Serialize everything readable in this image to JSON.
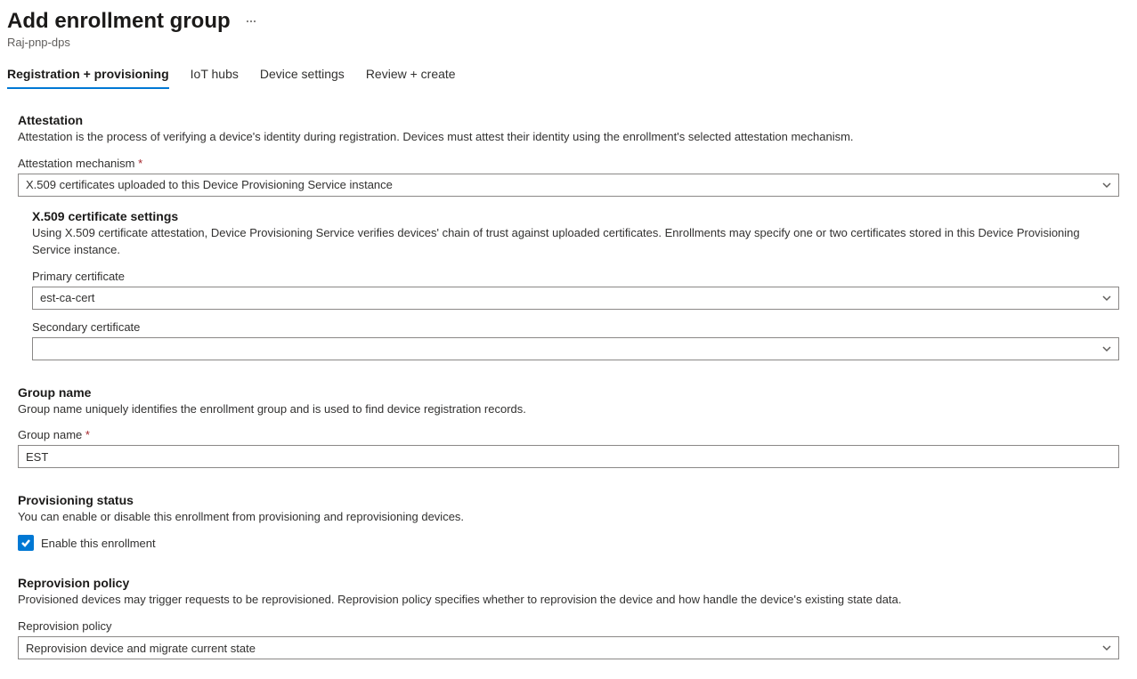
{
  "header": {
    "title": "Add enrollment group",
    "subtitle": "Raj-pnp-dps"
  },
  "tabs": [
    {
      "label": "Registration + provisioning",
      "active": true
    },
    {
      "label": "IoT hubs",
      "active": false
    },
    {
      "label": "Device settings",
      "active": false
    },
    {
      "label": "Review + create",
      "active": false
    }
  ],
  "attestation": {
    "title": "Attestation",
    "desc": "Attestation is the process of verifying a device's identity during registration. Devices must attest their identity using the enrollment's selected attestation mechanism.",
    "mechanism_label": "Attestation mechanism",
    "mechanism_value": "X.509 certificates uploaded to this Device Provisioning Service instance"
  },
  "x509": {
    "title": "X.509 certificate settings",
    "desc": "Using X.509 certificate attestation, Device Provisioning Service verifies devices' chain of trust against uploaded certificates. Enrollments may specify one or two certificates stored in this Device Provisioning Service instance.",
    "primary_label": "Primary certificate",
    "primary_value": "est-ca-cert",
    "secondary_label": "Secondary certificate",
    "secondary_value": ""
  },
  "group": {
    "title": "Group name",
    "desc": "Group name uniquely identifies the enrollment group and is used to find device registration records.",
    "name_label": "Group name",
    "name_value": "EST"
  },
  "provisioning": {
    "title": "Provisioning status",
    "desc": "You can enable or disable this enrollment from provisioning and reprovisioning devices.",
    "enable_label": "Enable this enrollment",
    "enabled": true
  },
  "reprovision": {
    "title": "Reprovision policy",
    "desc": "Provisioned devices may trigger requests to be reprovisioned. Reprovision policy specifies whether to reprovision the device and how handle the device's existing state data.",
    "policy_label": "Reprovision policy",
    "policy_value": "Reprovision device and migrate current state"
  }
}
